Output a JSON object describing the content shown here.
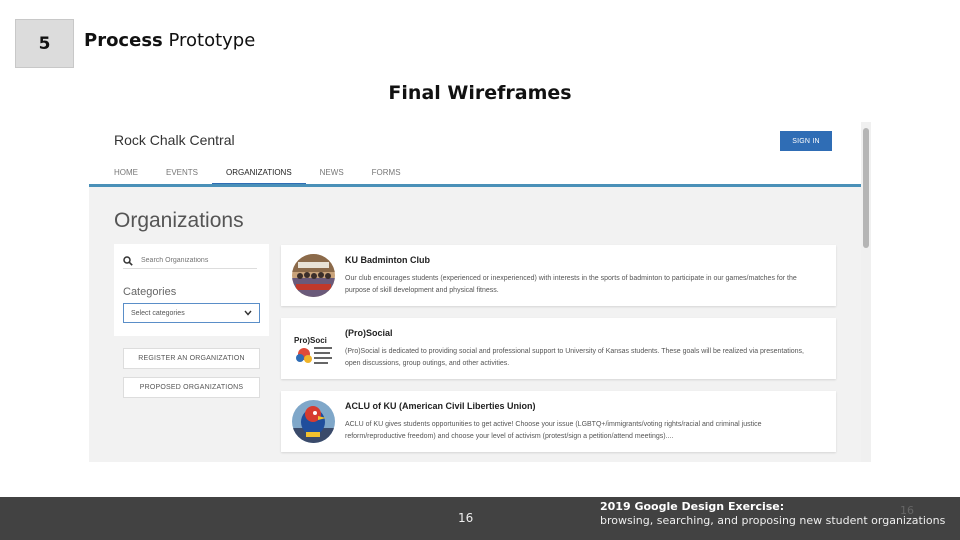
{
  "slide": {
    "step_number": "5",
    "title_bold": "Process",
    "title_rest": " Prototype",
    "subtitle": "Final Wireframes"
  },
  "app": {
    "site_title": "Rock Chalk Central",
    "signin_label": "SIGN IN",
    "nav": [
      "HOME",
      "EVENTS",
      "ORGANIZATIONS",
      "NEWS",
      "FORMS"
    ],
    "active_nav": "ORGANIZATIONS",
    "accent_color": "#2f6db5",
    "page_heading": "Organizations",
    "search_placeholder": "Search Organizations",
    "categories_label": "Categories",
    "categories_select": "Select categories",
    "register_button": "REGISTER AN ORGANIZATION",
    "proposed_button": "PROPOSED ORGANIZATIONS",
    "organizations": [
      {
        "name": "KU Badminton Club",
        "description": "Our club encourages students (experienced or inexperienced) with interests in the sports of badminton to participate in our games/matches for the purpose of skill development and physical fitness.",
        "logo_icon": "group-photo-icon"
      },
      {
        "name": "(Pro)Social",
        "description": "(Pro)Social is dedicated to providing social and professional support to University of Kansas students. These goals will be realized via presentations, open discussions, group outings, and other activities.",
        "logo_icon": "prosocial-logo-icon",
        "logo_text": "Pro)Soci"
      },
      {
        "name": "ACLU of KU (American Civil Liberties Union)",
        "description": "ACLU of KU gives students opportunities to get active! Choose your issue (LGBTQ+/immigrants/voting rights/racial and criminal justice reform/reproductive freedom) and choose your level of activism (protest/sign a petition/attend meetings)....",
        "logo_icon": "jayhawk-logo-icon"
      }
    ]
  },
  "footer": {
    "page_number": "16",
    "title": "2019 Google Design Exercise:",
    "subtitle": "browsing, searching, and proposing new student organizations",
    "ghost_number": "16"
  }
}
